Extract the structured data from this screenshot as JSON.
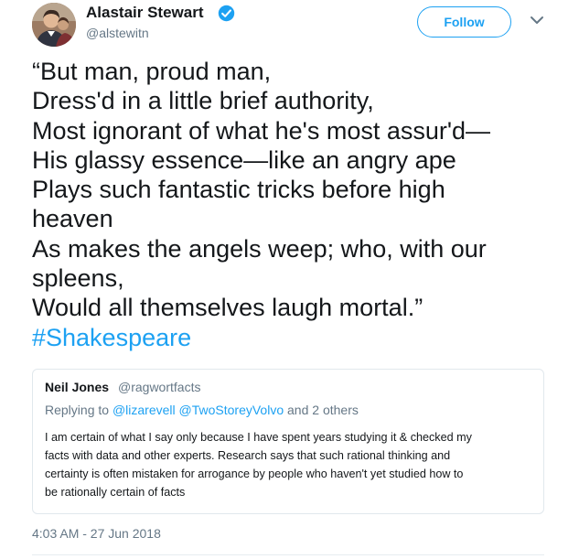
{
  "author": {
    "name": "Alastair Stewart",
    "handle": "@alstewitn",
    "verified": true,
    "avatar_icon": "person-photo-avatar"
  },
  "header": {
    "follow_label": "Follow",
    "more_icon": "chevron-down-icon"
  },
  "tweet": {
    "lines": [
      "“But man, proud man,",
      "Dress'd in a little brief authority,",
      "Most ignorant of what he's most assur'd—",
      "His glassy essence—like an angry ape",
      "Plays such fantastic tricks before high",
      "heaven",
      "As makes the angels weep; who, with our",
      "spleens,",
      "Would all themselves laugh mortal.”"
    ],
    "hashtag": "#Shakespeare"
  },
  "quoted_tweet": {
    "name": "Neil Jones",
    "handle": "@ragwortfacts",
    "replying_prefix": "Replying to",
    "mention_1": "@lizarevell",
    "mention_2": "@TwoStoreyVolvo",
    "replying_suffix": "and 2 others",
    "body_lines": [
      "I am certain of what I say only because I have spent years studying it & checked my",
      "facts with data and other experts. Research says that such rational thinking and",
      "certainty is often mistaken for arrogance by people who haven't yet studied how to",
      "be rationally certain of facts"
    ]
  },
  "timestamp": "4:03 AM - 27 Jun 2018",
  "colors": {
    "accent": "#1da1f2",
    "text": "#14171a",
    "muted": "#657786",
    "border": "#e1e8ed"
  }
}
